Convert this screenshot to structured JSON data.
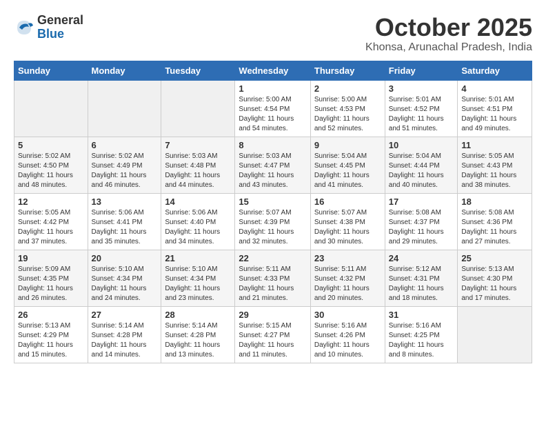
{
  "header": {
    "logo_general": "General",
    "logo_blue": "Blue",
    "month": "October 2025",
    "location": "Khonsa, Arunachal Pradesh, India"
  },
  "weekdays": [
    "Sunday",
    "Monday",
    "Tuesday",
    "Wednesday",
    "Thursday",
    "Friday",
    "Saturday"
  ],
  "weeks": [
    [
      {
        "day": "",
        "info": ""
      },
      {
        "day": "",
        "info": ""
      },
      {
        "day": "",
        "info": ""
      },
      {
        "day": "1",
        "info": "Sunrise: 5:00 AM\nSunset: 4:54 PM\nDaylight: 11 hours\nand 54 minutes."
      },
      {
        "day": "2",
        "info": "Sunrise: 5:00 AM\nSunset: 4:53 PM\nDaylight: 11 hours\nand 52 minutes."
      },
      {
        "day": "3",
        "info": "Sunrise: 5:01 AM\nSunset: 4:52 PM\nDaylight: 11 hours\nand 51 minutes."
      },
      {
        "day": "4",
        "info": "Sunrise: 5:01 AM\nSunset: 4:51 PM\nDaylight: 11 hours\nand 49 minutes."
      }
    ],
    [
      {
        "day": "5",
        "info": "Sunrise: 5:02 AM\nSunset: 4:50 PM\nDaylight: 11 hours\nand 48 minutes."
      },
      {
        "day": "6",
        "info": "Sunrise: 5:02 AM\nSunset: 4:49 PM\nDaylight: 11 hours\nand 46 minutes."
      },
      {
        "day": "7",
        "info": "Sunrise: 5:03 AM\nSunset: 4:48 PM\nDaylight: 11 hours\nand 44 minutes."
      },
      {
        "day": "8",
        "info": "Sunrise: 5:03 AM\nSunset: 4:47 PM\nDaylight: 11 hours\nand 43 minutes."
      },
      {
        "day": "9",
        "info": "Sunrise: 5:04 AM\nSunset: 4:45 PM\nDaylight: 11 hours\nand 41 minutes."
      },
      {
        "day": "10",
        "info": "Sunrise: 5:04 AM\nSunset: 4:44 PM\nDaylight: 11 hours\nand 40 minutes."
      },
      {
        "day": "11",
        "info": "Sunrise: 5:05 AM\nSunset: 4:43 PM\nDaylight: 11 hours\nand 38 minutes."
      }
    ],
    [
      {
        "day": "12",
        "info": "Sunrise: 5:05 AM\nSunset: 4:42 PM\nDaylight: 11 hours\nand 37 minutes."
      },
      {
        "day": "13",
        "info": "Sunrise: 5:06 AM\nSunset: 4:41 PM\nDaylight: 11 hours\nand 35 minutes."
      },
      {
        "day": "14",
        "info": "Sunrise: 5:06 AM\nSunset: 4:40 PM\nDaylight: 11 hours\nand 34 minutes."
      },
      {
        "day": "15",
        "info": "Sunrise: 5:07 AM\nSunset: 4:39 PM\nDaylight: 11 hours\nand 32 minutes."
      },
      {
        "day": "16",
        "info": "Sunrise: 5:07 AM\nSunset: 4:38 PM\nDaylight: 11 hours\nand 30 minutes."
      },
      {
        "day": "17",
        "info": "Sunrise: 5:08 AM\nSunset: 4:37 PM\nDaylight: 11 hours\nand 29 minutes."
      },
      {
        "day": "18",
        "info": "Sunrise: 5:08 AM\nSunset: 4:36 PM\nDaylight: 11 hours\nand 27 minutes."
      }
    ],
    [
      {
        "day": "19",
        "info": "Sunrise: 5:09 AM\nSunset: 4:35 PM\nDaylight: 11 hours\nand 26 minutes."
      },
      {
        "day": "20",
        "info": "Sunrise: 5:10 AM\nSunset: 4:34 PM\nDaylight: 11 hours\nand 24 minutes."
      },
      {
        "day": "21",
        "info": "Sunrise: 5:10 AM\nSunset: 4:34 PM\nDaylight: 11 hours\nand 23 minutes."
      },
      {
        "day": "22",
        "info": "Sunrise: 5:11 AM\nSunset: 4:33 PM\nDaylight: 11 hours\nand 21 minutes."
      },
      {
        "day": "23",
        "info": "Sunrise: 5:11 AM\nSunset: 4:32 PM\nDaylight: 11 hours\nand 20 minutes."
      },
      {
        "day": "24",
        "info": "Sunrise: 5:12 AM\nSunset: 4:31 PM\nDaylight: 11 hours\nand 18 minutes."
      },
      {
        "day": "25",
        "info": "Sunrise: 5:13 AM\nSunset: 4:30 PM\nDaylight: 11 hours\nand 17 minutes."
      }
    ],
    [
      {
        "day": "26",
        "info": "Sunrise: 5:13 AM\nSunset: 4:29 PM\nDaylight: 11 hours\nand 15 minutes."
      },
      {
        "day": "27",
        "info": "Sunrise: 5:14 AM\nSunset: 4:28 PM\nDaylight: 11 hours\nand 14 minutes."
      },
      {
        "day": "28",
        "info": "Sunrise: 5:14 AM\nSunset: 4:28 PM\nDaylight: 11 hours\nand 13 minutes."
      },
      {
        "day": "29",
        "info": "Sunrise: 5:15 AM\nSunset: 4:27 PM\nDaylight: 11 hours\nand 11 minutes."
      },
      {
        "day": "30",
        "info": "Sunrise: 5:16 AM\nSunset: 4:26 PM\nDaylight: 11 hours\nand 10 minutes."
      },
      {
        "day": "31",
        "info": "Sunrise: 5:16 AM\nSunset: 4:25 PM\nDaylight: 11 hours\nand 8 minutes."
      },
      {
        "day": "",
        "info": ""
      }
    ]
  ]
}
